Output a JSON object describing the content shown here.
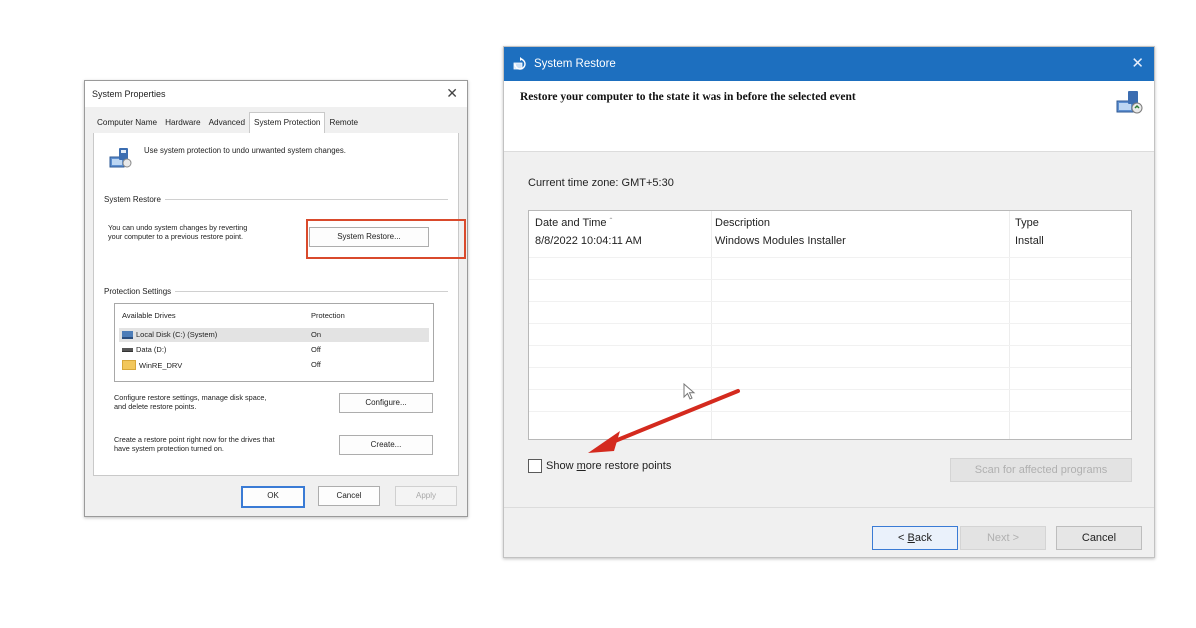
{
  "system_properties": {
    "title": "System Properties",
    "tabs": [
      "Computer Name",
      "Hardware",
      "Advanced",
      "System Protection",
      "Remote"
    ],
    "active_tab": "System Protection",
    "intro_text": "Use system protection to undo unwanted system changes.",
    "system_restore_label": "System Restore",
    "system_restore_desc_line1": "You can undo system changes by reverting",
    "system_restore_desc_line2": "your computer to a previous restore point.",
    "system_restore_button": "System Restore...",
    "protection_settings_label": "Protection Settings",
    "drives_header": {
      "available": "Available Drives",
      "protection": "Protection"
    },
    "drives": [
      {
        "name": "Local Disk (C:) (System)",
        "protection": "On",
        "icon": "hard-drive-icon"
      },
      {
        "name": "Data (D:)",
        "protection": "Off",
        "icon": "drive-icon"
      },
      {
        "name": "WinRE_DRV",
        "protection": "Off",
        "icon": "folder-icon"
      }
    ],
    "configure_desc_line1": "Configure restore settings, manage disk space,",
    "configure_desc_line2": "and delete restore points.",
    "configure_button": "Configure...",
    "create_desc_line1": "Create a restore point right now for the drives that",
    "create_desc_line2": "have system protection turned on.",
    "create_button": "Create...",
    "ok_button": "OK",
    "cancel_button": "Cancel",
    "apply_button": "Apply"
  },
  "system_restore": {
    "title": "System Restore",
    "heading": "Restore your computer to the state it was in before the selected event",
    "timezone": "Current time zone: GMT+5:30",
    "columns": [
      "Date and Time",
      "Description",
      "Type"
    ],
    "rows": [
      {
        "date": "8/8/2022 10:04:11 AM",
        "description": "Windows Modules Installer",
        "type": "Install"
      }
    ],
    "show_more": {
      "prefix": "Show ",
      "accel": "m",
      "suffix": "ore restore points",
      "checked": false
    },
    "scan_button": "Scan for affected programs",
    "back": {
      "prefix": "< ",
      "accel": "B",
      "suffix": "ack"
    },
    "next_button": "Next >",
    "cancel_button": "Cancel"
  },
  "colors": {
    "highlight": "#d94a2c",
    "arrow": "#d42a1e",
    "titlebar": "#1d6fbf"
  }
}
